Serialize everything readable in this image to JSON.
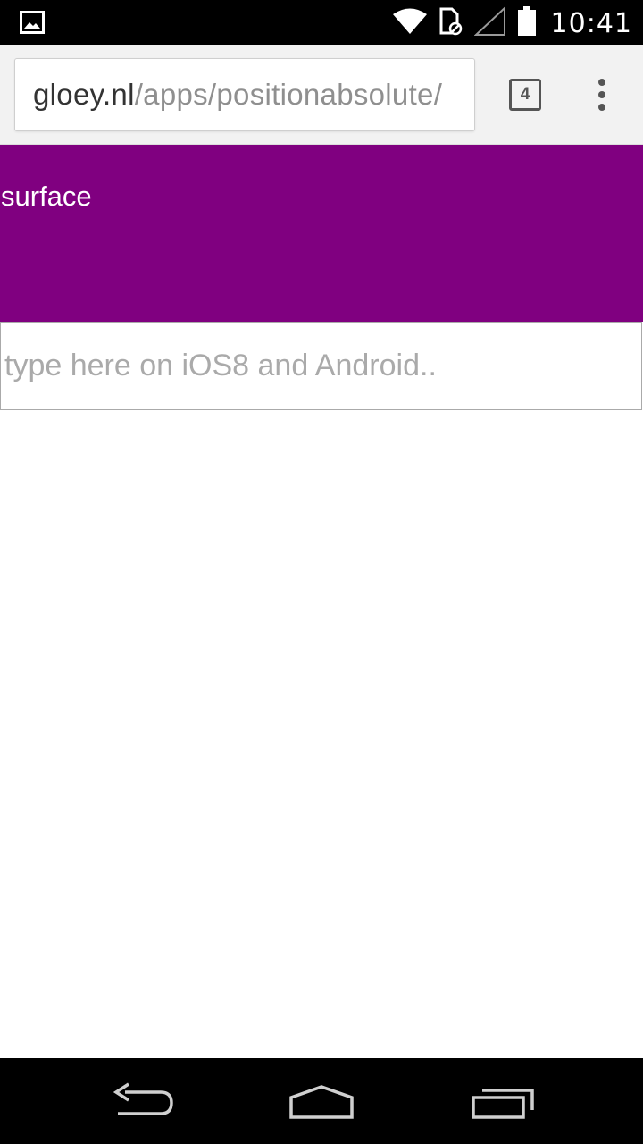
{
  "status_bar": {
    "time": "10:41",
    "left_icons": [
      "image-notification-icon"
    ],
    "right_icons": [
      "wifi-icon",
      "sim-card-icon",
      "cell-signal-icon",
      "battery-icon"
    ]
  },
  "browser": {
    "url_domain": "gloey.nl",
    "url_path": "/apps/positionabsolute/",
    "tab_count": "4",
    "menu_icon": "overflow-menu-icon"
  },
  "page": {
    "surface_label": "surface",
    "input_placeholder": "type here on iOS8 and Android..",
    "input_value": ""
  },
  "nav_bar": {
    "buttons": [
      "back-icon",
      "home-icon",
      "recent-apps-icon"
    ]
  },
  "colors": {
    "surface": "#800080",
    "status_bar": "#000000",
    "nav_bar": "#000000",
    "toolbar": "#f2f2f2"
  }
}
